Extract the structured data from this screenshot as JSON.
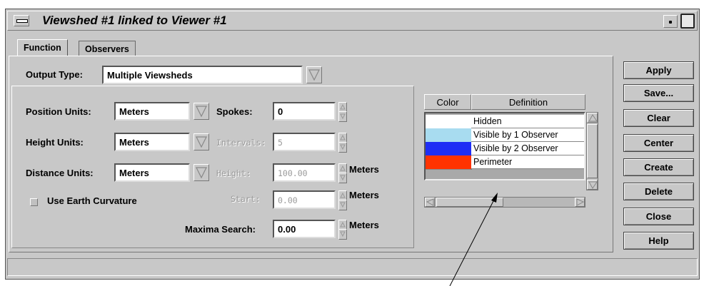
{
  "window": {
    "title": "Viewshed #1 linked to Viewer #1"
  },
  "tabs": [
    {
      "label": "Function",
      "active": true
    },
    {
      "label": "Observers",
      "active": false
    }
  ],
  "output_type": {
    "label": "Output Type:",
    "value": "Multiple Viewsheds"
  },
  "position_units": {
    "label": "Position Units:",
    "value": "Meters"
  },
  "height_units": {
    "label": "Height Units:",
    "value": "Meters"
  },
  "distance_units": {
    "label": "Distance Units:",
    "value": "Meters"
  },
  "spokes": {
    "label": "Spokes:",
    "value": "0"
  },
  "intervals": {
    "label": "Intervals:",
    "value": "5"
  },
  "height": {
    "label": "Height:",
    "value": "100.00",
    "unit": "Meters"
  },
  "start": {
    "label": "Start:",
    "value": "0.00",
    "unit": "Meters"
  },
  "maxima": {
    "label": "Maxima Search:",
    "value": "0.00",
    "unit": "Meters"
  },
  "earth_curvature": {
    "label": "Use Earth Curvature",
    "checked": false
  },
  "table": {
    "headers": [
      "Color",
      "Definition"
    ],
    "rows": [
      {
        "color": "#ffffff",
        "definition": "Hidden"
      },
      {
        "color": "#a8dcf0",
        "definition": "Visible by 1 Observer"
      },
      {
        "color": "#1e2ef5",
        "definition": "Visible by 2 Observer"
      },
      {
        "color": "#ff3300",
        "definition": "Perimeter"
      }
    ]
  },
  "buttons": [
    "Apply",
    "Save...",
    "Clear",
    "Center",
    "Create",
    "Delete",
    "Close",
    "Help"
  ],
  "status_text": ""
}
